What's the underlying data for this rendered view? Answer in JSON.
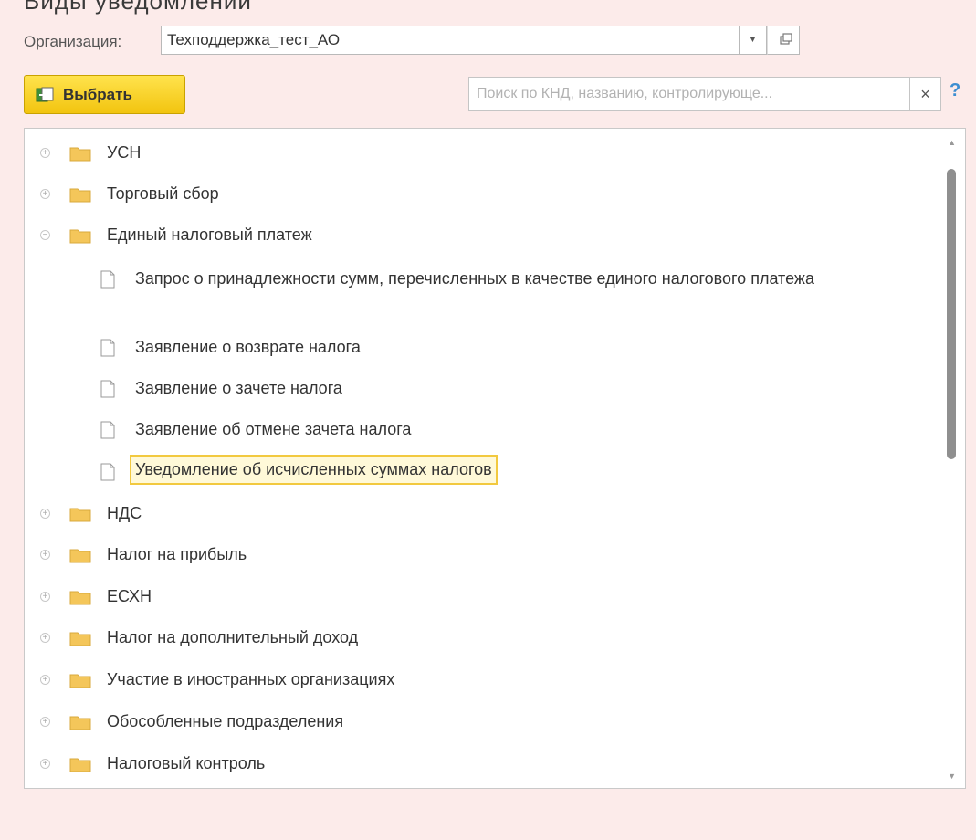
{
  "title_fragment": "Виды уведомлений",
  "organization": {
    "label": "Организация:",
    "value": "Техподдержка_тест_АО"
  },
  "toolbar": {
    "select_label": "Выбрать",
    "search_placeholder": "Поиск по КНД, названию, контролирующе...",
    "clear_label": "×",
    "help_label": "?"
  },
  "tree": [
    {
      "label": "УСН",
      "type": "folder",
      "expanded": false
    },
    {
      "label": "Торговый сбор",
      "type": "folder",
      "expanded": false
    },
    {
      "label": "Единый налоговый платеж",
      "type": "folder",
      "expanded": true
    },
    {
      "label": "Запрос о принадлежности сумм, перечисленных в качестве единого налогового платежа",
      "type": "document"
    },
    {
      "label": "Заявление о возврате налога",
      "type": "document"
    },
    {
      "label": "Заявление о зачете налога",
      "type": "document"
    },
    {
      "label": "Заявление об отмене зачета налога",
      "type": "document"
    },
    {
      "label": "Уведомление об исчисленных суммах налогов",
      "type": "document",
      "selected": true
    },
    {
      "label": "НДС",
      "type": "folder",
      "expanded": false
    },
    {
      "label": "Налог на прибыль",
      "type": "folder",
      "expanded": false
    },
    {
      "label": "ЕСХН",
      "type": "folder",
      "expanded": false
    },
    {
      "label": "Налог на дополнительный доход",
      "type": "folder",
      "expanded": false
    },
    {
      "label": "Участие в иностранных организациях",
      "type": "folder",
      "expanded": false
    },
    {
      "label": "Обособленные подразделения",
      "type": "folder",
      "expanded": false
    },
    {
      "label": "Налоговый контроль",
      "type": "folder",
      "expanded": false
    }
  ],
  "colors": {
    "background": "#fcebea",
    "button_yellow": "#f2c40f",
    "folder": "#f4c65a",
    "selection": "#f2c93f",
    "help": "#3d8ed1"
  }
}
